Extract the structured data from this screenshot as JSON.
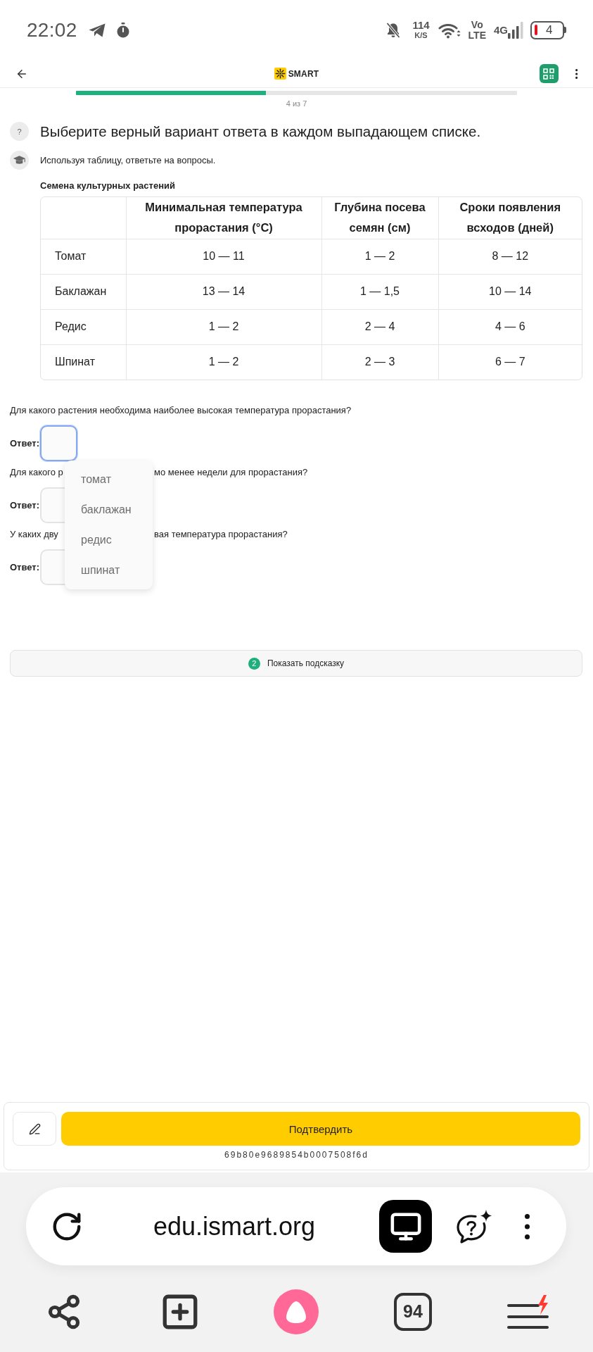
{
  "status_bar": {
    "time": "22:02",
    "speed": {
      "value": "114",
      "unit": "K/S"
    },
    "volte": [
      "Vo",
      "LTE"
    ],
    "network": "4G",
    "battery": "4"
  },
  "header": {
    "logo": "SMART"
  },
  "progress": {
    "label": "4 из 7",
    "level": 0.43
  },
  "task": {
    "badge": "?",
    "title": "Выберите верный вариант ответа в каждом выпадающем списке.",
    "instruction": "Используя таблицу, ответьте на вопросы."
  },
  "table": {
    "caption": "Семена культурных растений",
    "columns": [
      "Минимальная температура прорастания (°C)",
      "Глубина посева семян (см)",
      "Сроки появления всходов (дней)"
    ],
    "rows": [
      {
        "name": "Томат",
        "cells": [
          "10 — 11",
          "1 — 2",
          "8 — 12"
        ]
      },
      {
        "name": "Баклажан",
        "cells": [
          "13 — 14",
          "1 — 1,5",
          "10 — 14"
        ]
      },
      {
        "name": "Редис",
        "cells": [
          "1 — 2",
          "2 — 4",
          "4 — 6"
        ]
      },
      {
        "name": "Шпинат",
        "cells": [
          "1 — 2",
          "2 — 3",
          "6 — 7"
        ]
      }
    ]
  },
  "questions": [
    {
      "text_parts": [
        "Для какого растения необходима наиболее высокая температура прорастания?"
      ],
      "answer_label": "Ответ:",
      "answer": {
        "focused": true,
        "options": [
          {
            "label": "томат",
            "selected": false
          },
          {
            "label": "баклажан",
            "selected": false
          },
          {
            "label": "редис",
            "selected": false
          },
          {
            "label": "шпинат",
            "selected": false
          }
        ]
      }
    },
    {
      "text_parts": [
        "Для какого р",
        "мо менее недели для прорастания?"
      ],
      "answer_label": "Ответ:",
      "answer": {
        "focused": false
      }
    },
    {
      "text_parts": [
        "У каких дву",
        "вая температура прорастания?"
      ],
      "answer_label": "Ответ:",
      "answer": {
        "focused": false
      }
    }
  ],
  "hint": {
    "count": "2",
    "label": "Показать подсказку"
  },
  "footer": {
    "submit": "Подтвердить",
    "id": "69b80e9689854b0007508f6d"
  },
  "browser": {
    "url": "edu.ismart.org",
    "tabs_count": "94"
  }
}
